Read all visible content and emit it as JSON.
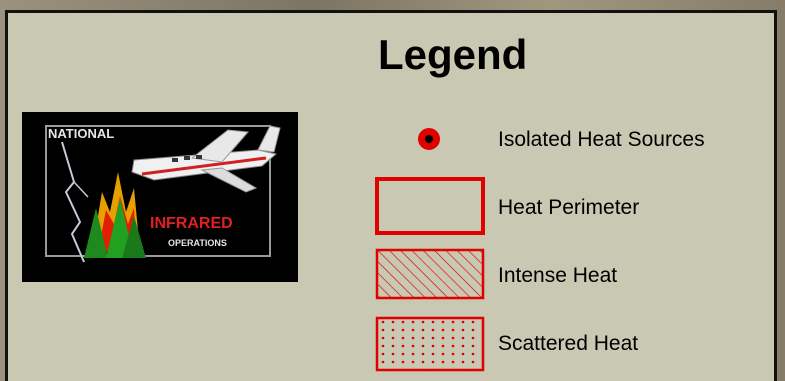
{
  "legend": {
    "title": "Legend",
    "logo": {
      "text_top": "NATIONAL",
      "text_middle": "INFRARED",
      "text_bottom": "OPERATIONS"
    },
    "items": [
      {
        "label": "Isolated Heat Sources",
        "symbol": "red-dot-with-black-center"
      },
      {
        "label": "Heat Perimeter",
        "symbol": "red-outline-rectangle"
      },
      {
        "label": "Intense Heat",
        "symbol": "red-hatched-rectangle"
      },
      {
        "label": "Scattered Heat",
        "symbol": "red-dotted-rectangle"
      }
    ],
    "colors": {
      "panel_background": "#c8c8b3",
      "symbol_red": "#e00000",
      "border": "#111111"
    }
  }
}
